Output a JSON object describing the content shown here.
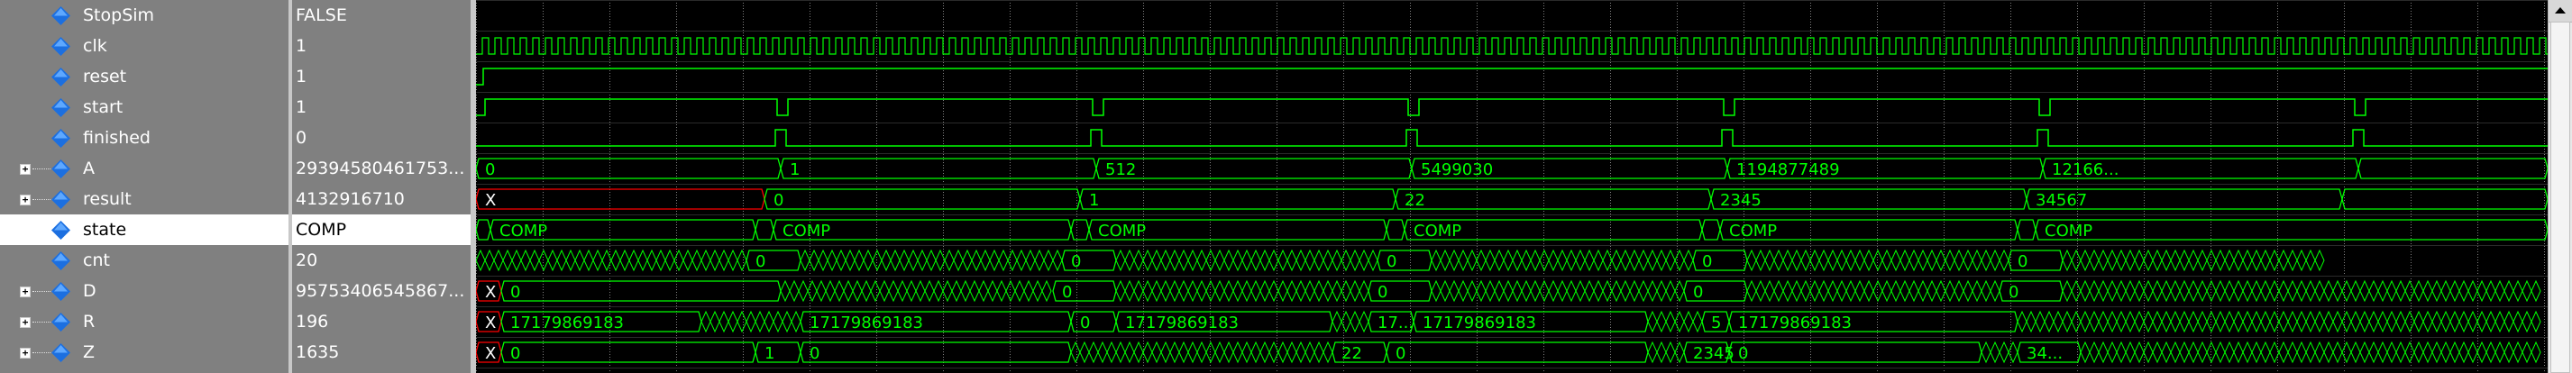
{
  "signals": [
    {
      "name": "StopSim",
      "value": "FALSE",
      "expandable": false,
      "selected": false
    },
    {
      "name": "clk",
      "value": "1",
      "expandable": false,
      "selected": false
    },
    {
      "name": "reset",
      "value": "1",
      "expandable": false,
      "selected": false
    },
    {
      "name": "start",
      "value": "1",
      "expandable": false,
      "selected": false
    },
    {
      "name": "finished",
      "value": "0",
      "expandable": false,
      "selected": false
    },
    {
      "name": "A",
      "value": "29394580461753...",
      "expandable": true,
      "selected": false
    },
    {
      "name": "result",
      "value": "4132916710",
      "expandable": true,
      "selected": false
    },
    {
      "name": "state",
      "value": "COMP",
      "expandable": false,
      "selected": true
    },
    {
      "name": "cnt",
      "value": "20",
      "expandable": false,
      "selected": false
    },
    {
      "name": "D",
      "value": "95753406545867...",
      "expandable": true,
      "selected": false
    },
    {
      "name": "R",
      "value": "196",
      "expandable": true,
      "selected": false
    },
    {
      "name": "Z",
      "value": "1635",
      "expandable": true,
      "selected": false
    }
  ],
  "wave_labels": {
    "A": [
      "0",
      "1",
      "512",
      "5499030",
      "1194877489",
      "12166..."
    ],
    "result": [
      "X",
      "0",
      "1",
      "22",
      "2345",
      "34567"
    ],
    "state": [
      "COMP",
      "COMP",
      "COMP",
      "COMP",
      "COMP",
      "COMP"
    ],
    "cnt": [
      "0",
      "0",
      "0",
      "0",
      "0"
    ],
    "D": [
      "X",
      "0",
      "0",
      "0",
      "0",
      "0"
    ],
    "R": [
      "X",
      "17179869183",
      "17179869183",
      "0",
      "17179869183",
      "17...",
      "17179869183",
      "5",
      "17179869183"
    ],
    "Z": [
      "X",
      "0",
      "1",
      "0",
      "22",
      "0",
      "2345",
      "0",
      "34..."
    ]
  },
  "colors": {
    "wave": "#00ff00",
    "undefined": "#ff0000",
    "background": "#000000",
    "grid": "#808080",
    "diamond": "#1c6fe0",
    "panel": "#808080"
  },
  "icons": {
    "signal": "diamond-icon",
    "expand": "plus-icon",
    "scroll_up": "arrow-up-icon"
  },
  "expander_glyph": "+"
}
